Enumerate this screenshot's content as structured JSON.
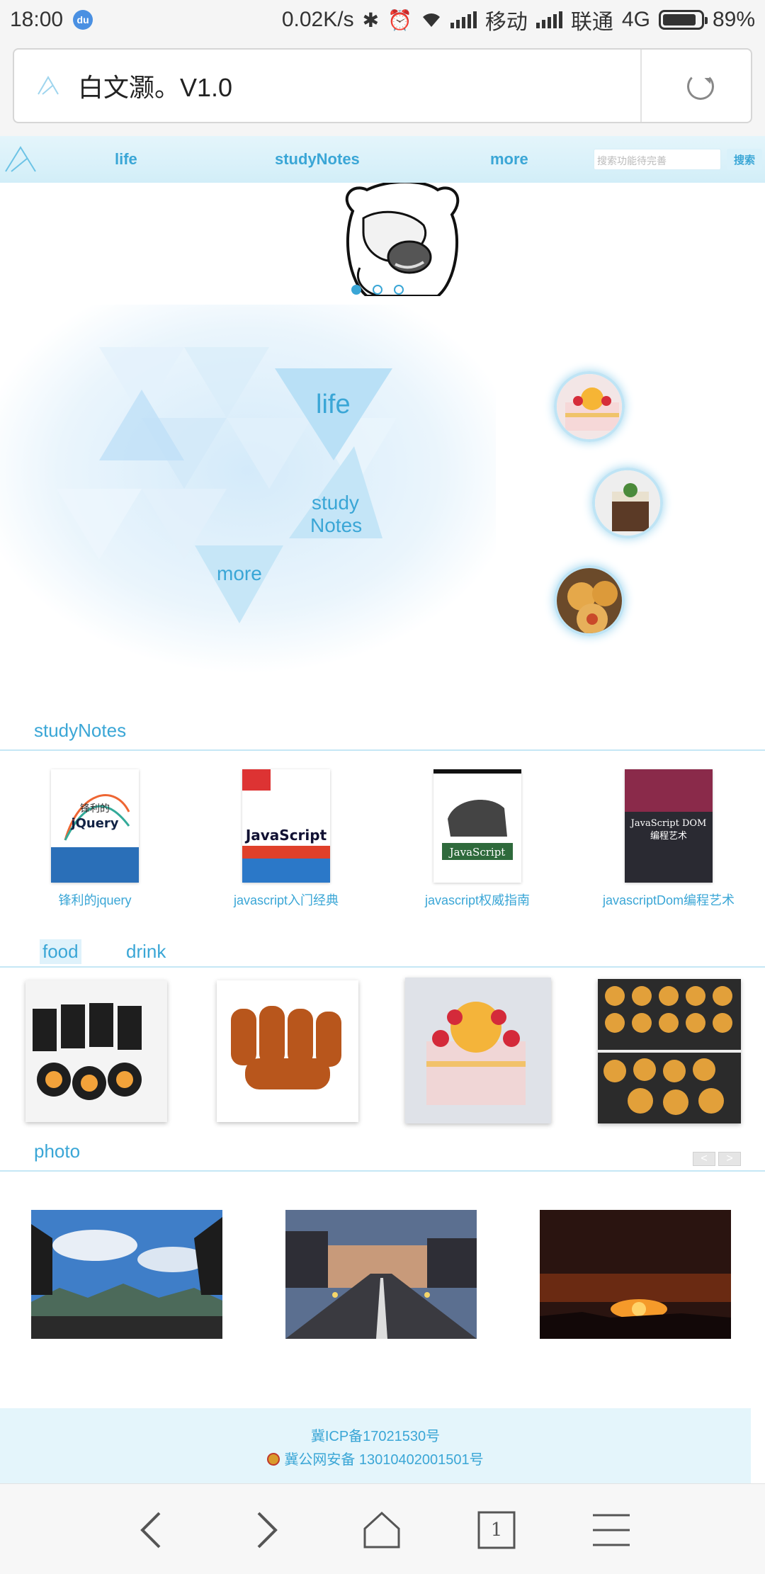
{
  "status_bar": {
    "time": "18:00",
    "app_badge": "du",
    "speed": "0.02K/s",
    "carrier1": "移动",
    "carrier2": "联通",
    "network": "4G",
    "battery": "89%",
    "battery_level": 0.89
  },
  "browser": {
    "page_title": "白文灏。V1.0"
  },
  "site_nav": {
    "items": [
      "life",
      "studyNotes",
      "more"
    ],
    "search_placeholder": "搜索功能待完善",
    "search_button": "搜索"
  },
  "banner": {
    "slide_count": 3,
    "active_slide": 1
  },
  "triangles": {
    "life": "life",
    "study": "study",
    "notes": "Notes",
    "more": "more"
  },
  "sections": {
    "study_notes": "studyNotes",
    "food_tab": "food",
    "drink_tab": "drink",
    "photo": "photo"
  },
  "books": [
    {
      "title": "锋利的jquery"
    },
    {
      "title": "javascript入门经典"
    },
    {
      "title": "javascript权威指南"
    },
    {
      "title": "javascriptDom编程艺术"
    }
  ],
  "photo_pager": {
    "prev": "<",
    "next": ">"
  },
  "footer": {
    "icp": "冀ICP备17021530号",
    "police": "冀公网安备 13010402001501号"
  },
  "bottom_bar": {
    "tab_count": "1"
  },
  "colors": {
    "accent": "#3aa6d6",
    "nav_bg": "#d2eef8"
  }
}
